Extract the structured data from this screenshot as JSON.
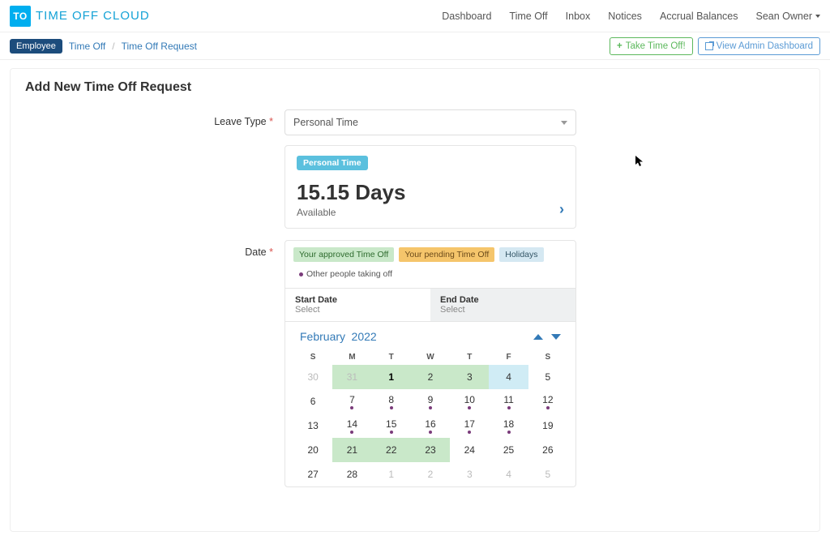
{
  "brand": {
    "logo": "TO",
    "name": "TIME OFF CLOUD"
  },
  "nav": {
    "dashboard": "Dashboard",
    "timeoff": "Time Off",
    "inbox": "Inbox",
    "notices": "Notices",
    "accrual": "Accrual Balances",
    "user": "Sean Owner"
  },
  "breadcrumb": {
    "role": "Employee",
    "l1": "Time Off",
    "l2": "Time Off Request"
  },
  "actions": {
    "take": "Take Time Off!",
    "admin": "View Admin Dashboard"
  },
  "page": {
    "title": "Add New Time Off Request"
  },
  "form": {
    "leave_type_label": "Leave Type",
    "leave_type_value": "Personal Time",
    "date_label": "Date"
  },
  "balance": {
    "tag": "Personal Time",
    "value": "15.15 Days",
    "sub": "Available"
  },
  "legend": {
    "approved": "Your approved Time Off",
    "pending": "Your pending Time Off",
    "holidays": "Holidays",
    "others": "Other people taking off"
  },
  "dateTabs": {
    "start_label": "Start Date",
    "start_val": "Select",
    "end_label": "End Date",
    "end_val": "Select"
  },
  "calendar": {
    "month": "February",
    "year": "2022",
    "dow": [
      "S",
      "M",
      "T",
      "W",
      "T",
      "F",
      "S"
    ],
    "weeks": [
      [
        {
          "n": "30",
          "muted": true
        },
        {
          "n": "31",
          "muted": true,
          "hl": "grn"
        },
        {
          "n": "1",
          "hl": "grn",
          "bold": true
        },
        {
          "n": "2",
          "hl": "grn"
        },
        {
          "n": "3",
          "hl": "grn"
        },
        {
          "n": "4",
          "hl": "blu"
        },
        {
          "n": "5"
        }
      ],
      [
        {
          "n": "6"
        },
        {
          "n": "7",
          "dot": true
        },
        {
          "n": "8",
          "dot": true
        },
        {
          "n": "9",
          "dot": true
        },
        {
          "n": "10",
          "dot": true
        },
        {
          "n": "11",
          "dot": true
        },
        {
          "n": "12",
          "dot": true
        }
      ],
      [
        {
          "n": "13"
        },
        {
          "n": "14",
          "dot": true
        },
        {
          "n": "15",
          "dot": true
        },
        {
          "n": "16",
          "dot": true
        },
        {
          "n": "17",
          "dot": true
        },
        {
          "n": "18",
          "dot": true
        },
        {
          "n": "19"
        }
      ],
      [
        {
          "n": "20"
        },
        {
          "n": "21",
          "hl": "grn"
        },
        {
          "n": "22",
          "hl": "grn"
        },
        {
          "n": "23",
          "hl": "grn"
        },
        {
          "n": "24"
        },
        {
          "n": "25"
        },
        {
          "n": "26"
        }
      ],
      [
        {
          "n": "27"
        },
        {
          "n": "28"
        },
        {
          "n": "1",
          "muted": true
        },
        {
          "n": "2",
          "muted": true
        },
        {
          "n": "3",
          "muted": true
        },
        {
          "n": "4",
          "muted": true
        },
        {
          "n": "5",
          "muted": true
        }
      ]
    ]
  }
}
